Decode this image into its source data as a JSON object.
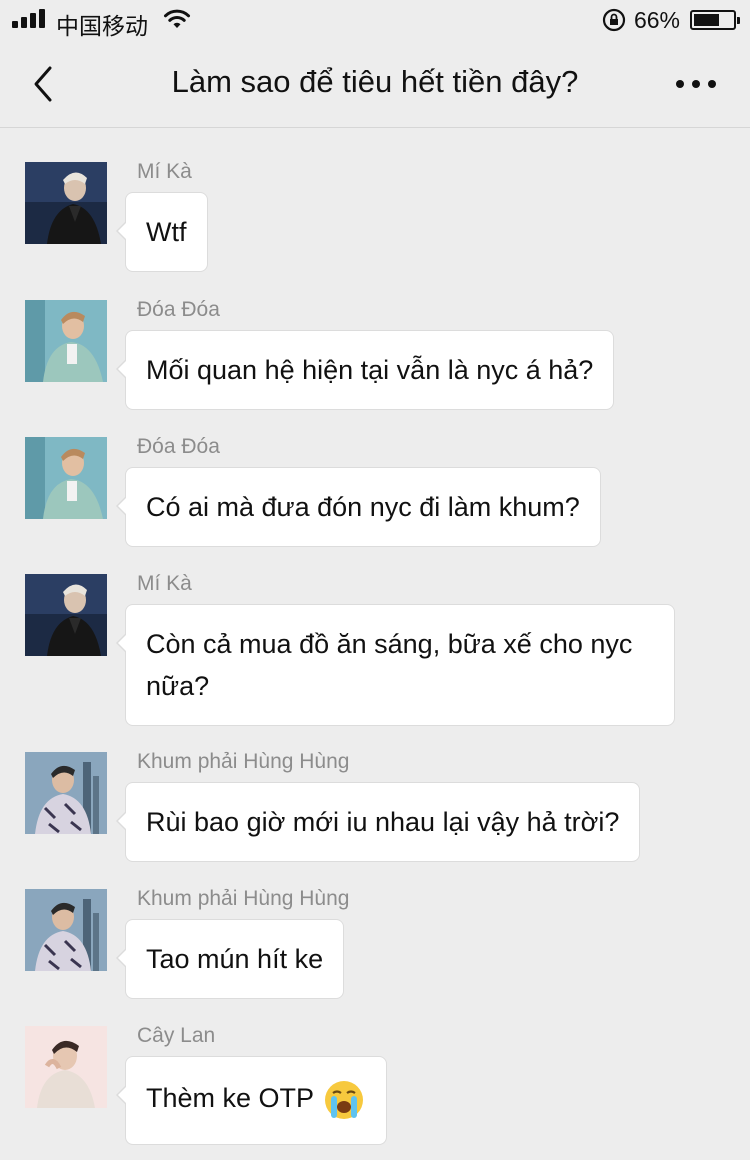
{
  "status_bar": {
    "carrier": "中国移动",
    "battery_percent": "66%",
    "battery_level": 0.66
  },
  "header": {
    "title": "Làm sao để tiêu hết tiền đây?",
    "back_icon": "chevron-left-icon",
    "more_icon": "more-horizontal-icon"
  },
  "colors": {
    "background": "#ededed",
    "bubble": "#ffffff",
    "sender_text": "#8c8c8c",
    "text": "#111111"
  },
  "messages": [
    {
      "sender": "Mí Kà",
      "text": "Wtf",
      "avatar": "avatar-mi-ka"
    },
    {
      "sender": "Đóa Đóa",
      "text": "Mối quan hệ hiện tại vẫn là nyc á hả?",
      "avatar": "avatar-doa-doa"
    },
    {
      "sender": "Đóa Đóa",
      "text": "Có ai mà đưa đón nyc đi làm khum?",
      "avatar": "avatar-doa-doa"
    },
    {
      "sender": "Mí Kà",
      "text": "Còn cả mua đồ ăn sáng, bữa xế cho nyc nữa?",
      "avatar": "avatar-mi-ka"
    },
    {
      "sender": "Khum phải Hùng Hùng",
      "text": "Rùi bao giờ mới iu nhau lại vậy hả trời?",
      "avatar": "avatar-hung-hung"
    },
    {
      "sender": "Khum phải Hùng Hùng",
      "text": "Tao mún hít ke",
      "avatar": "avatar-hung-hung"
    },
    {
      "sender": "Cây Lan",
      "text": "Thèm ke OTP",
      "avatar": "avatar-cay-lan",
      "emoji": "crying-face-icon"
    }
  ]
}
